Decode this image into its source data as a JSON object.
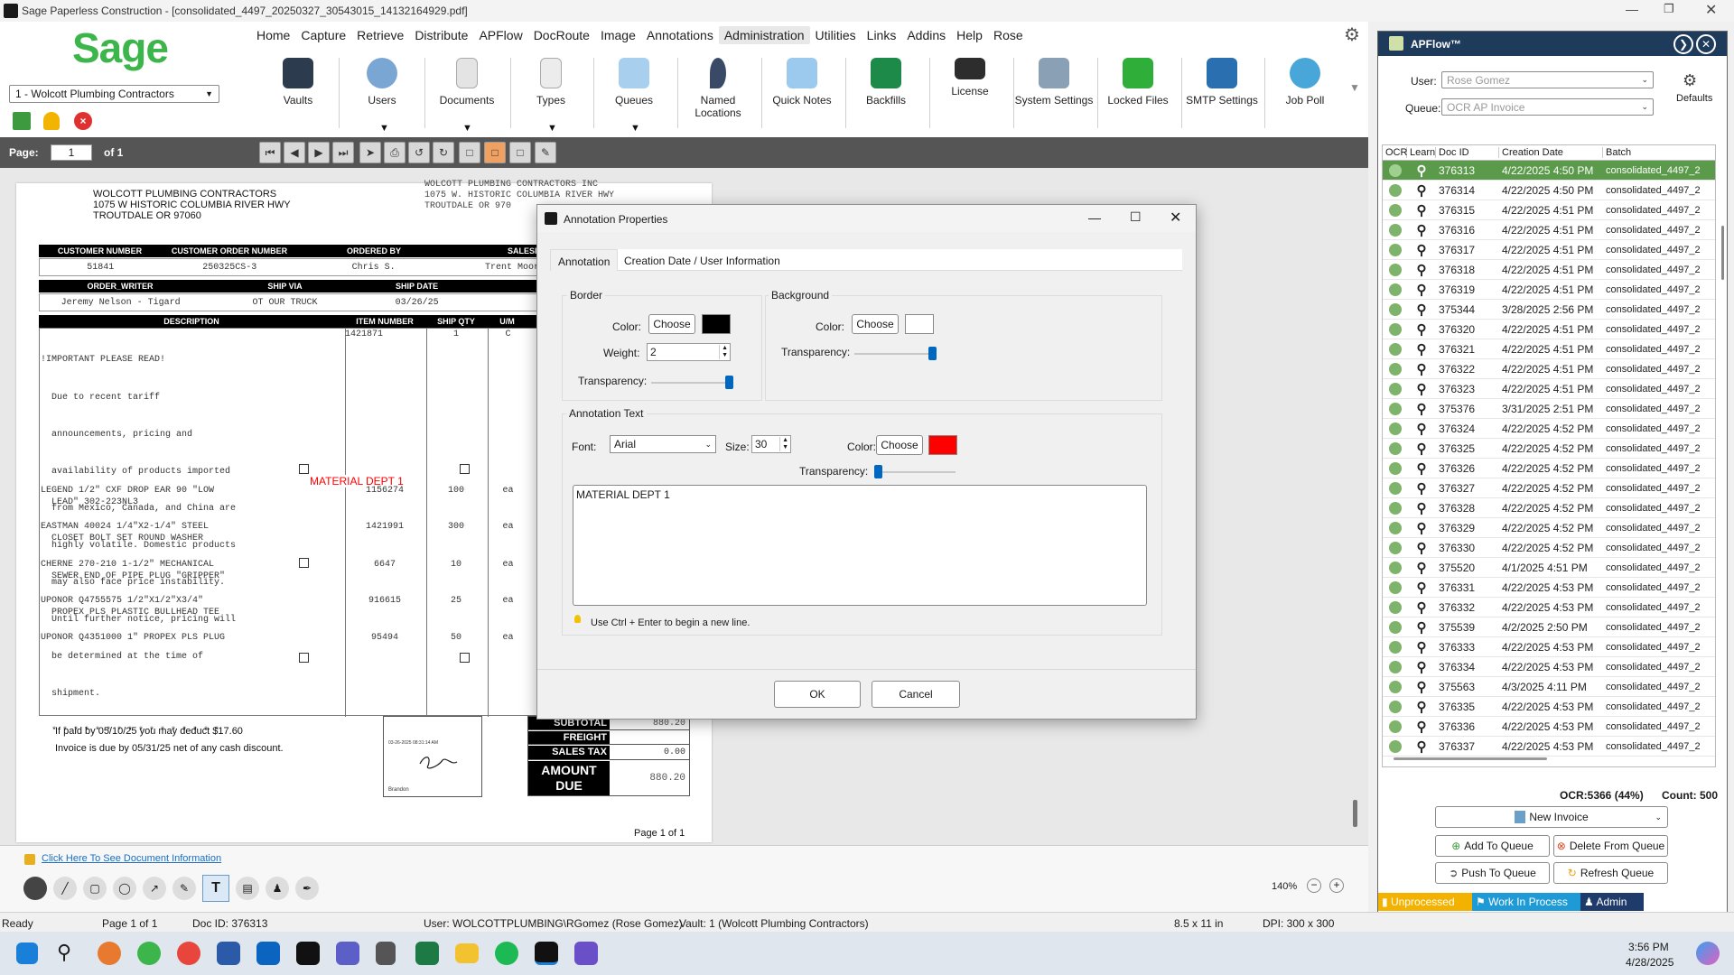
{
  "window": {
    "title": "Sage Paperless Construction - [consolidated_4497_20250327_30543015_14132164929.pdf]"
  },
  "logo": {
    "text": "Sage"
  },
  "company_select": {
    "value": "1 - Wolcott Plumbing Contractors"
  },
  "menu": [
    "Home",
    "Capture",
    "Retrieve",
    "Distribute",
    "APFlow",
    "DocRoute",
    "Image",
    "Annotations",
    "Administration",
    "Utilities",
    "Links",
    "Addins",
    "Help",
    "Rose"
  ],
  "ribbon": [
    "Vaults",
    "Users",
    "Documents",
    "Types",
    "Queues",
    "Named Locations",
    "Quick Notes",
    "Backfills",
    "License",
    "System Settings",
    "Locked Files",
    "SMTP Settings",
    "Job Poll"
  ],
  "pagebar": {
    "label": "Page:",
    "value": "1",
    "of": "of 1"
  },
  "doc": {
    "vendor": [
      "WOLCOTT PLUMBING CONTRACTORS",
      "1075 W HISTORIC COLUMBIA RIVER HWY",
      "TROUTDALE  OR  97060"
    ],
    "vendor2": [
      "WOLCOTT PLUMBING CONTRACTORS INC",
      "1075 W. HISTORIC COLUMBIA RIVER HWY",
      "TROUTDALE  OR  970"
    ],
    "h1": [
      "CUSTOMER NUMBER",
      "CUSTOMER ORDER NUMBER",
      "ORDERED BY",
      "SALESPE"
    ],
    "v1": [
      "51841",
      "250325CS-3",
      "Chris S.",
      "Trent Moore"
    ],
    "h2": [
      "ORDER_WRITER",
      "SHIP VIA",
      "SHIP DATE"
    ],
    "v2": [
      "Jeremy Nelson - Tigard",
      "OT OUR TRUCK",
      "03/26/25"
    ],
    "h3": [
      "DESCRIPTION",
      "ITEM NUMBER",
      "SHIP QTY",
      "U/M"
    ],
    "notice": [
      "!IMPORTANT PLEASE READ!",
      "  Due to recent tariff",
      "  announcements, pricing and",
      "  availability of products imported",
      "  from Mexico, Canada, and China are",
      "  highly volatile. Domestic products",
      "  may also face price instability.",
      "  Until further notice, pricing will",
      "  be determined at the time of",
      "  shipment.",
      "  * * * * * * * * * * * * * * * *"
    ],
    "notice_item": "1421871",
    "notice_qty": "1",
    "notice_um": "C",
    "annotation": "MATERIAL DEPT 1",
    "items": [
      {
        "d1": "LEGEND 1/2\" CXF DROP EAR 90 \"LOW",
        "d2": "  LEAD\" 302-223NL3",
        "item": "1156274",
        "qty": "100",
        "um": "ea"
      },
      {
        "d1": "EASTMAN 40024 1/4\"X2-1/4\" STEEL",
        "d2": "  CLOSET BOLT SET ROUND WASHER",
        "item": "1421991",
        "qty": "300",
        "um": "ea"
      },
      {
        "d1": "CHERNE 270-210 1-1/2\" MECHANICAL",
        "d2": "  SEWER END OF PIPE PLUG \"GRIPPER\"",
        "item": "6647",
        "qty": "10",
        "um": "ea"
      },
      {
        "d1": "UPONOR Q4755575 1/2\"X1/2\"X3/4\"",
        "d2": "  PROPEX PLS PLASTIC BULLHEAD TEE",
        "item": "916615",
        "qty": "25",
        "um": "ea"
      },
      {
        "d1": "UPONOR Q4351000 1\" PROPEX PLS PLUG",
        "d2": "",
        "item": "95494",
        "qty": "50",
        "um": "ea"
      }
    ],
    "terms1": "If paid by 05/10/25 you may deduct $17.60",
    "terms2": "Invoice is due by 05/31/25 net of any cash discount.",
    "stamp_date": "03-26-2025 08:31:14 AM",
    "stamp_name": "Brandon",
    "totals": [
      {
        "label": "SUBTOTAL",
        "value": "880.20"
      },
      {
        "label": "FREIGHT",
        "value": ""
      },
      {
        "label": "SALES TAX",
        "value": "0.00"
      }
    ],
    "amount_due_label1": "AMOUNT",
    "amount_due_label2": "DUE",
    "amount_due": "880.20",
    "pagefoot": "Page 1 of 1"
  },
  "dialog": {
    "title": "Annotation Properties",
    "tabs": [
      "Annotation",
      "Creation Date / User Information"
    ],
    "border": {
      "title": "Border",
      "color_label": "Color:",
      "choose": "Choose",
      "color": "#000000",
      "weight_label": "Weight:",
      "weight": "2",
      "transparency_label": "Transparency:"
    },
    "background": {
      "title": "Background",
      "color_label": "Color:",
      "choose": "Choose",
      "color": "#ffffff",
      "transparency_label": "Transparency:"
    },
    "text": {
      "title": "Annotation Text",
      "font_label": "Font:",
      "font": "Arial",
      "size_label": "Size:",
      "size": "30",
      "color_label": "Color:",
      "choose": "Choose",
      "color": "#ff0000",
      "transparency_label": "Transparency:",
      "value": "MATERIAL DEPT 1"
    },
    "hint": "Use Ctrl + Enter to begin a new line.",
    "ok": "OK",
    "cancel": "Cancel"
  },
  "apflow": {
    "title": "APFlow™",
    "user_label": "User:",
    "user": "Rose Gomez",
    "queue_label": "Queue:",
    "queue": "OCR AP Invoice",
    "defaults": "Defaults",
    "columns": [
      "OCR",
      "Learn",
      "Doc ID",
      "Creation Date",
      "Batch"
    ],
    "rows": [
      {
        "id": "376313",
        "date": "4/22/2025 4:50 PM",
        "batch": "consolidated_4497_2"
      },
      {
        "id": "376314",
        "date": "4/22/2025 4:50 PM",
        "batch": "consolidated_4497_2"
      },
      {
        "id": "376315",
        "date": "4/22/2025 4:51 PM",
        "batch": "consolidated_4497_2"
      },
      {
        "id": "376316",
        "date": "4/22/2025 4:51 PM",
        "batch": "consolidated_4497_2"
      },
      {
        "id": "376317",
        "date": "4/22/2025 4:51 PM",
        "batch": "consolidated_4497_2"
      },
      {
        "id": "376318",
        "date": "4/22/2025 4:51 PM",
        "batch": "consolidated_4497_2"
      },
      {
        "id": "376319",
        "date": "4/22/2025 4:51 PM",
        "batch": "consolidated_4497_2"
      },
      {
        "id": "375344",
        "date": "3/28/2025 2:56 PM",
        "batch": "consolidated_4497_2"
      },
      {
        "id": "376320",
        "date": "4/22/2025 4:51 PM",
        "batch": "consolidated_4497_2"
      },
      {
        "id": "376321",
        "date": "4/22/2025 4:51 PM",
        "batch": "consolidated_4497_2"
      },
      {
        "id": "376322",
        "date": "4/22/2025 4:51 PM",
        "batch": "consolidated_4497_2"
      },
      {
        "id": "376323",
        "date": "4/22/2025 4:51 PM",
        "batch": "consolidated_4497_2"
      },
      {
        "id": "375376",
        "date": "3/31/2025 2:51 PM",
        "batch": "consolidated_4497_2"
      },
      {
        "id": "376324",
        "date": "4/22/2025 4:52 PM",
        "batch": "consolidated_4497_2"
      },
      {
        "id": "376325",
        "date": "4/22/2025 4:52 PM",
        "batch": "consolidated_4497_2"
      },
      {
        "id": "376326",
        "date": "4/22/2025 4:52 PM",
        "batch": "consolidated_4497_2"
      },
      {
        "id": "376327",
        "date": "4/22/2025 4:52 PM",
        "batch": "consolidated_4497_2"
      },
      {
        "id": "376328",
        "date": "4/22/2025 4:52 PM",
        "batch": "consolidated_4497_2"
      },
      {
        "id": "376329",
        "date": "4/22/2025 4:52 PM",
        "batch": "consolidated_4497_2"
      },
      {
        "id": "376330",
        "date": "4/22/2025 4:52 PM",
        "batch": "consolidated_4497_2"
      },
      {
        "id": "375520",
        "date": "4/1/2025 4:51 PM",
        "batch": "consolidated_4497_2"
      },
      {
        "id": "376331",
        "date": "4/22/2025 4:53 PM",
        "batch": "consolidated_4497_2"
      },
      {
        "id": "376332",
        "date": "4/22/2025 4:53 PM",
        "batch": "consolidated_4497_2"
      },
      {
        "id": "375539",
        "date": "4/2/2025 2:50 PM",
        "batch": "consolidated_4497_2"
      },
      {
        "id": "376333",
        "date": "4/22/2025 4:53 PM",
        "batch": "consolidated_4497_2"
      },
      {
        "id": "376334",
        "date": "4/22/2025 4:53 PM",
        "batch": "consolidated_4497_2"
      },
      {
        "id": "375563",
        "date": "4/3/2025 4:11 PM",
        "batch": "consolidated_4497_2"
      },
      {
        "id": "376335",
        "date": "4/22/2025 4:53 PM",
        "batch": "consolidated_4497_2"
      },
      {
        "id": "376336",
        "date": "4/22/2025 4:53 PM",
        "batch": "consolidated_4497_2"
      },
      {
        "id": "376337",
        "date": "4/22/2025 4:53 PM",
        "batch": "consolidated_4497_2"
      }
    ],
    "ocr_stat": "OCR:5366 (44%)",
    "count": "Count: 500",
    "new_invoice": "New Invoice",
    "add_queue": "Add To Queue",
    "delete_queue": "Delete From Queue",
    "push_queue": "Push To Queue",
    "refresh_queue": "Refresh Queue",
    "tabs": [
      "Unprocessed",
      "Work In Process",
      "Admin"
    ]
  },
  "annotbar": {
    "link": "Click Here To See Document Information",
    "zoom": "140%"
  },
  "status": {
    "ready": "Ready",
    "page": "Page 1 of 1",
    "doc": "Doc ID: 376313",
    "user": "User: WOLCOTTPLUMBING\\RGomez (Rose Gomez)",
    "vault": "Vault: 1 (Wolcott Plumbing Contractors)",
    "size": "8.5 x 11 in",
    "dpi": "DPI: 300 x 300"
  },
  "clock": {
    "time": "3:56 PM",
    "date": "4/28/2025"
  },
  "colors": {
    "accent": "#0067c0",
    "sage_green": "#3cb54a",
    "apflow_header": "#1f3b5c",
    "row_selected": "#5a9a4a"
  }
}
